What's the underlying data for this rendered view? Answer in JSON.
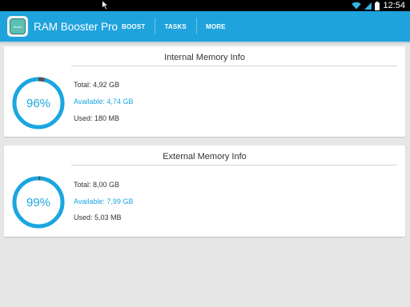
{
  "status_bar": {
    "time": "12:54",
    "icons": [
      "wifi-icon",
      "signal-icon",
      "battery-icon"
    ]
  },
  "action_bar": {
    "app_title": "RAM Booster Pro",
    "app_icon": "ram-booster-app-icon",
    "app_icon_text": "Boost",
    "tabs": [
      {
        "label": "BOOST"
      },
      {
        "label": "TASKS"
      },
      {
        "label": "MORE"
      }
    ]
  },
  "colors": {
    "accent": "#1fa3dd",
    "gauge_ring": "#1ba6e1",
    "gauge_marker": "#555555",
    "background": "#e6e6e6"
  },
  "internal": {
    "title": "Internal Memory Info",
    "percent_label": "96%",
    "percent_value": 96,
    "total": "Total: 4,92 GB",
    "available": "Available: 4,74 GB",
    "used": "Used: 180 MB"
  },
  "external": {
    "title": "External Memory Info",
    "percent_label": "99%",
    "percent_value": 99,
    "total": "Total: 8,00 GB",
    "available": "Available: 7,99 GB",
    "used": "Used: 5,03 MB"
  }
}
